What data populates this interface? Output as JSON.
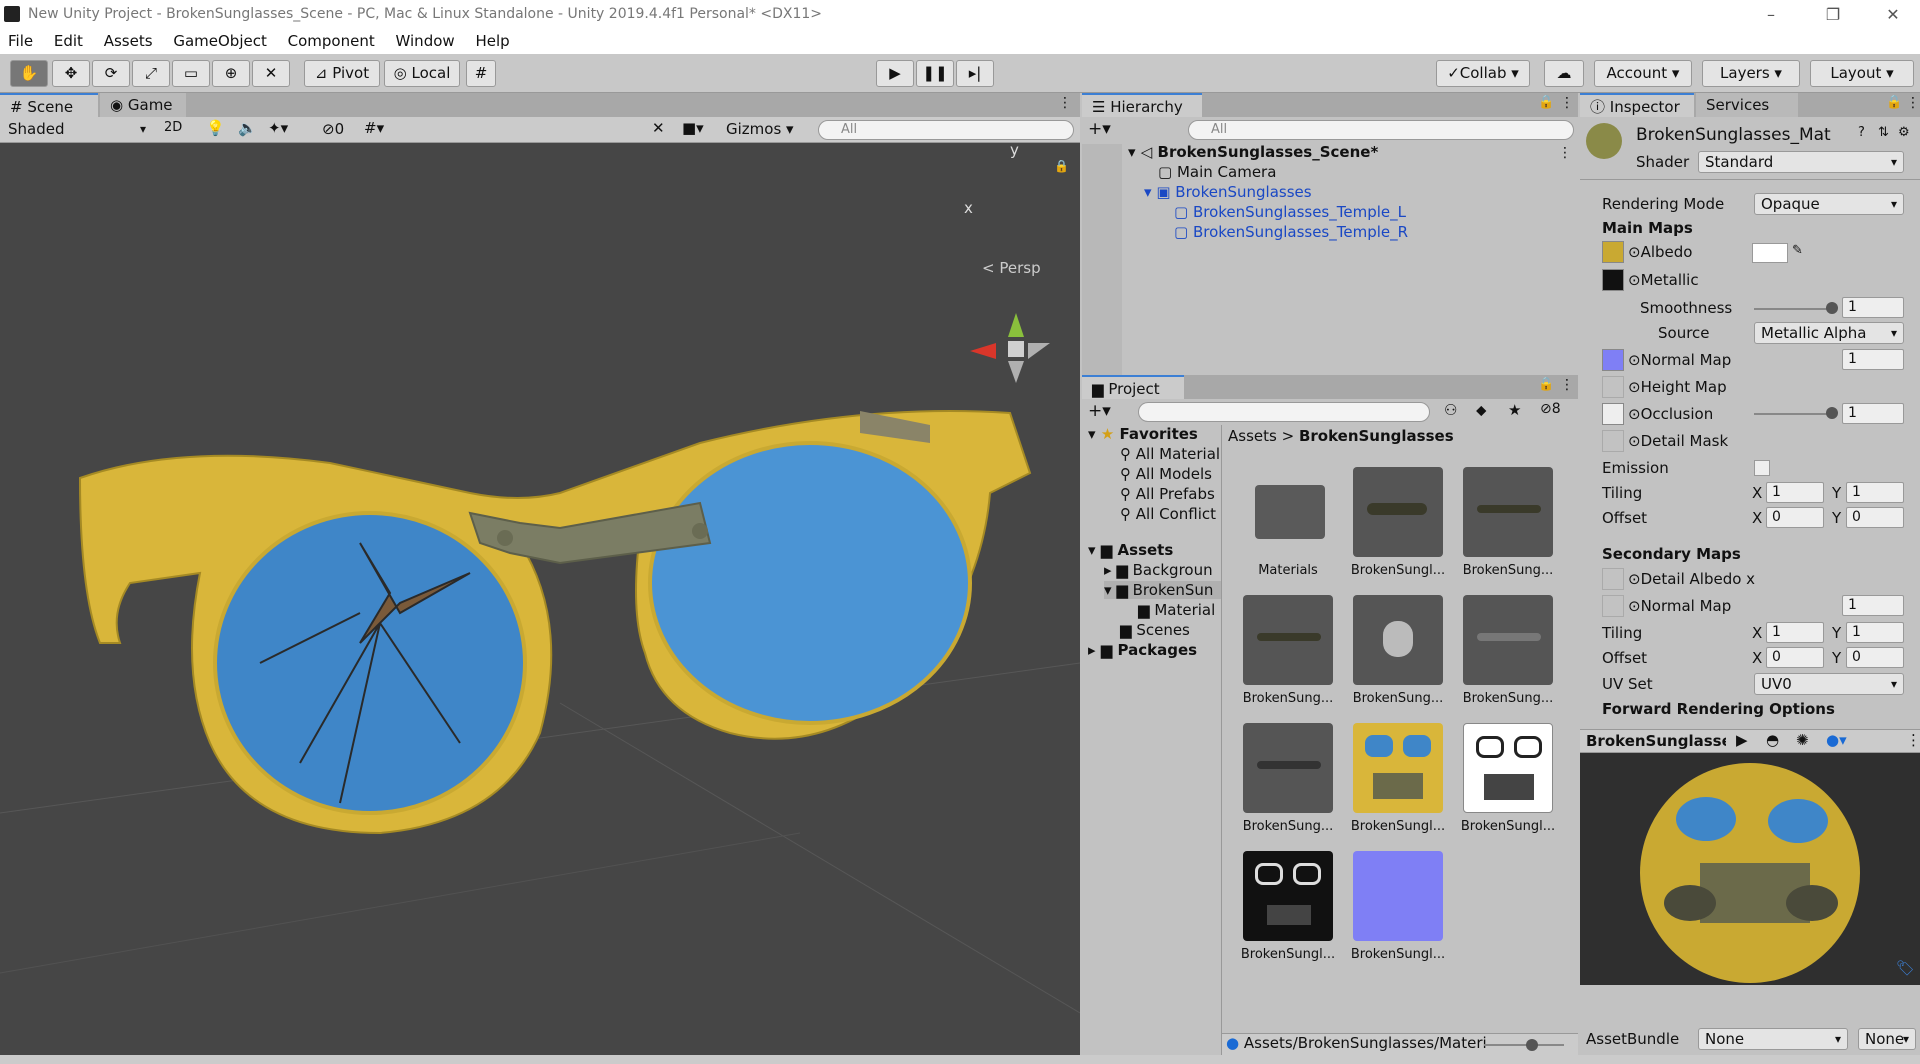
{
  "window": {
    "title": "New Unity Project - BrokenSunglasses_Scene - PC, Mac & Linux Standalone - Unity 2019.4.4f1 Personal* <DX11>",
    "controls": [
      "–",
      "❐",
      "✕"
    ]
  },
  "menu": [
    "File",
    "Edit",
    "Assets",
    "GameObject",
    "Component",
    "Window",
    "Help"
  ],
  "toolbar": {
    "pivot_label": "Pivot",
    "local_label": "Local",
    "collab_label": "Collab",
    "account_label": "Account",
    "layers_label": "Layers",
    "layout_label": "Layout"
  },
  "scene_panel": {
    "tabs": [
      "Scene",
      "Game"
    ],
    "shading_mode": "Shaded",
    "mode_2d": "2D",
    "hidden_count": "0",
    "gizmos_label": "Gizmos",
    "search_placeholder": "All",
    "axis_y": "y",
    "axis_x": "x",
    "projection": "Persp"
  },
  "hierarchy": {
    "tab": "Hierarchy",
    "search_placeholder": "All",
    "scene_name": "BrokenSunglasses_Scene*",
    "items": [
      {
        "label": "Main Camera",
        "depth": 1,
        "prefab": false
      },
      {
        "label": "BrokenSunglasses",
        "depth": 1,
        "prefab": true
      },
      {
        "label": "BrokenSunglasses_Temple_L",
        "depth": 2,
        "prefab": true
      },
      {
        "label": "BrokenSunglasses_Temple_R",
        "depth": 2,
        "prefab": true
      }
    ]
  },
  "project": {
    "tab": "Project",
    "hidden_count": "8",
    "favorites_label": "Favorites",
    "favorites": [
      "All Material",
      "All Models",
      "All Prefabs",
      "All Conflict"
    ],
    "assets_label": "Assets",
    "asset_folders": [
      "Backgroun",
      "BrokenSun",
      "Material",
      "Scenes"
    ],
    "packages_label": "Packages",
    "breadcrumb_root": "Assets",
    "breadcrumb_current": "BrokenSunglasses",
    "grid": [
      {
        "label": "Materials"
      },
      {
        "label": "BrokenSungl..."
      },
      {
        "label": "BrokenSung..."
      },
      {
        "label": "BrokenSung..."
      },
      {
        "label": "BrokenSung..."
      },
      {
        "label": "BrokenSung..."
      },
      {
        "label": "BrokenSung..."
      },
      {
        "label": "BrokenSungl..."
      },
      {
        "label": "BrokenSungl..."
      },
      {
        "label": "BrokenSungl..."
      },
      {
        "label": "BrokenSungl..."
      }
    ],
    "path_footer": "Assets/BrokenSunglasses/Materi"
  },
  "inspector": {
    "tabs": [
      "Inspector",
      "Services"
    ],
    "material_name": "BrokenSunglasses_Mat",
    "shader_label": "Shader",
    "shader_value": "Standard",
    "rendering_mode_label": "Rendering Mode",
    "rendering_mode_value": "Opaque",
    "main_maps": "Main Maps",
    "albedo": "Albedo",
    "metallic": "Metallic",
    "smoothness_label": "Smoothness",
    "smoothness_value": "1",
    "source_label": "Source",
    "source_value": "Metallic Alpha",
    "normal_map": "Normal Map",
    "normal_map_value": "1",
    "height_map": "Height Map",
    "occlusion": "Occlusion",
    "occlusion_value": "1",
    "detail_mask": "Detail Mask",
    "emission": "Emission",
    "tiling": "Tiling",
    "offset": "Offset",
    "x": "X",
    "y": "Y",
    "tiling_x": "1",
    "tiling_y": "1",
    "offset_x": "0",
    "offset_y": "0",
    "secondary_maps": "Secondary Maps",
    "detail_albedo": "Detail Albedo x",
    "sec_normal_map": "Normal Map",
    "sec_normal_value": "1",
    "sec_tiling_x": "1",
    "sec_tiling_y": "1",
    "sec_offset_x": "0",
    "sec_offset_y": "0",
    "uv_set_label": "UV Set",
    "uv_set_value": "UV0",
    "forward_rendering": "Forward Rendering Options",
    "preview_title": "BrokenSunglasses",
    "assetbundle_label": "AssetBundle",
    "assetbundle_value": "None",
    "assetbundle_variant": "None"
  },
  "colors": {
    "accent": "#3c7fd4",
    "prefab_blue": "#1a48c4",
    "frame_yellow": "#d9b63a",
    "lens_blue": "#3f86c8",
    "normal_map_purple": "#7f7ff5"
  }
}
